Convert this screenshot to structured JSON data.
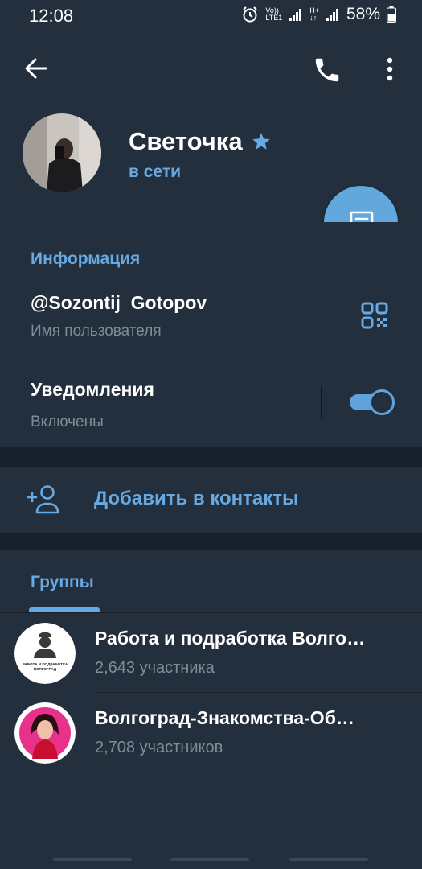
{
  "status_bar": {
    "time": "12:08",
    "volte_line1": "Vo))",
    "volte_line2": "LTE1",
    "hplus_line1": "H+",
    "hplus_line2": "↓↑",
    "battery_percent": "58%"
  },
  "header": {
    "name": "Светочка",
    "status": "в сети",
    "icons": {
      "back": "arrow-left-icon",
      "call": "phone-icon",
      "menu": "more-vertical-icon",
      "verified": "star-icon",
      "message": "message-icon"
    }
  },
  "info": {
    "section_title": "Информация",
    "username": "@Sozontij_Gotopov",
    "username_caption": "Имя пользователя",
    "notifications_label": "Уведомления",
    "notifications_state": "Включены",
    "notifications_enabled": true
  },
  "actions": {
    "add_contact": "Добавить в контакты"
  },
  "groups": {
    "tab_label": "Группы",
    "items": [
      {
        "name": "Работа и подработка Волго…",
        "members": "2,643 участника",
        "avatar_text_1": "РАБОТА И ПОДРАБОТКА",
        "avatar_text_2": "ВОЛГОГРАД"
      },
      {
        "name": "Волгоград-Знакомства-Об…",
        "members": "2,708 участников"
      }
    ]
  },
  "colors": {
    "background": "#1d2733",
    "panel": "#232f3c",
    "accent": "#67a9e3",
    "fab": "#62a8dd",
    "secondary_text": "#7f8d9a"
  }
}
